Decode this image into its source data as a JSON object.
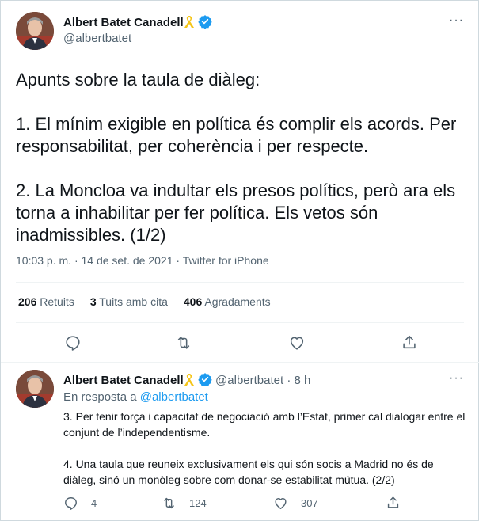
{
  "colors": {
    "accent": "#1d9bf0",
    "muted": "#536471",
    "text": "#0f1419",
    "divider": "#eff3f4",
    "ribbon": "#f5c518"
  },
  "main_tweet": {
    "author_name": "Albert Batet Canadell",
    "handle": "@albertbatet",
    "more_label": "···",
    "paragraphs": [
      "Apunts sobre la taula de diàleg:",
      "1. El mínim exigible en política és complir els acords. Per responsabilitat, per coherència i per respecte.",
      "2. La Moncloa va indultar els presos polítics, però ara els torna a inhabilitar per fer política. Els vetos són inadmissibles. (1/2)"
    ],
    "time": "10:03 p. m.",
    "date": "14 de set. de 2021",
    "separator": "·",
    "source": "Twitter for iPhone",
    "stats": [
      {
        "count": "206",
        "label": "Retuits"
      },
      {
        "count": "3",
        "label": "Tuits amb cita"
      },
      {
        "count": "406",
        "label": "Agradaments"
      }
    ],
    "icons": [
      "reply-icon",
      "retweet-icon",
      "like-icon",
      "share-icon"
    ]
  },
  "reply_tweet": {
    "author_name": "Albert Batet Canadell",
    "handle": "@albertbatet",
    "separator": "·",
    "age": "8 h",
    "more_label": "···",
    "reply_prefix": "En resposta a",
    "reply_handle": "@albertbatet",
    "paragraphs": [
      "3. Per tenir força i capacitat de negociació amb l’Estat, primer cal dialogar entre el conjunt de l’independentisme.",
      "4. Una taula que reuneix exclusivament els qui són socis a Madrid no és de diàleg, sinó un monòleg sobre com donar-se estabilitat mútua. (2/2)"
    ],
    "reply_count": "4",
    "retweet_count": "124",
    "like_count": "307"
  }
}
